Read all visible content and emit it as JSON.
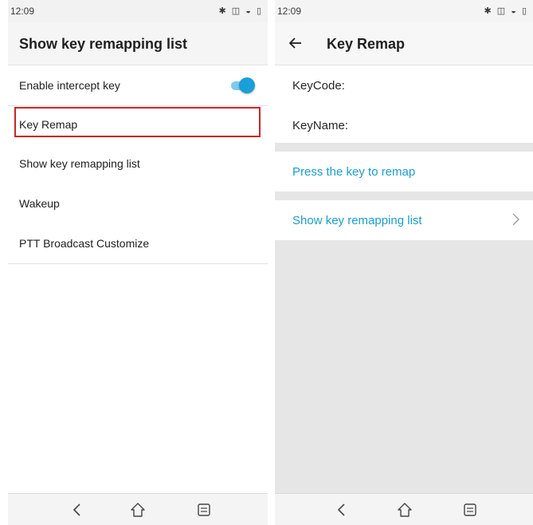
{
  "left": {
    "status": {
      "time": "12:09",
      "icons": [
        "bluetooth-icon",
        "vibrate-icon",
        "wifi-icon",
        "battery-icon"
      ]
    },
    "header": {
      "title": "Show key remapping list"
    },
    "items": [
      {
        "label": "Enable intercept key",
        "toggle_on": true
      },
      {
        "label": "Key Remap",
        "highlighted": true
      },
      {
        "label": "Show key remapping list"
      },
      {
        "label": "Wakeup"
      },
      {
        "label": "PTT Broadcast Customize"
      }
    ]
  },
  "right": {
    "status": {
      "time": "12:09",
      "icons": [
        "bluetooth-icon",
        "vibrate-icon",
        "wifi-icon",
        "battery-icon"
      ]
    },
    "header": {
      "title": "Key Remap",
      "back_icon": "back-arrow-icon"
    },
    "keycode_label": "KeyCode:",
    "keyname_label": "KeyName:",
    "press_key_label": "Press the key to remap",
    "show_list_label": "Show key remapping list"
  },
  "nav": {
    "icons": [
      "back-icon",
      "home-icon",
      "recents-icon"
    ]
  },
  "colors": {
    "accent": "#1a9fd8",
    "highlight_border": "#c62828",
    "link_text": "#1a9ec9"
  }
}
